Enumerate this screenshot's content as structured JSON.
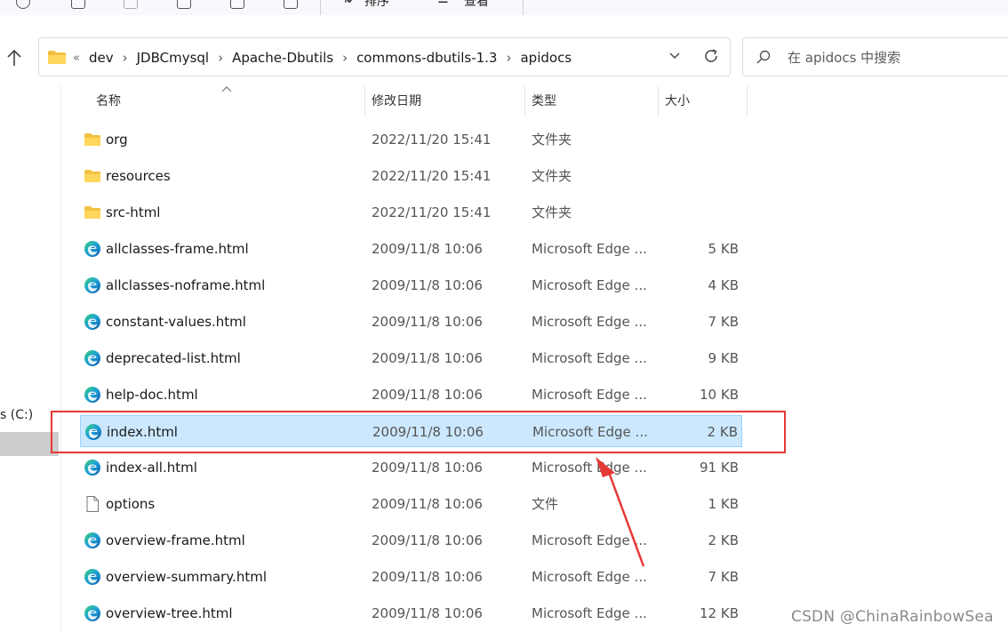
{
  "toolbar": {
    "sort_label": "排序",
    "view_label": "查看",
    "more_label": "···"
  },
  "address_bar": {
    "overflow_marker": "«",
    "crumbs": [
      "dev",
      "JDBCmysql",
      "Apache-Dbutils",
      "commons-dbutils-1.3",
      "apidocs"
    ]
  },
  "search": {
    "placeholder": "在 apidocs 中搜索"
  },
  "nav": {
    "drive_label": "s (C:)"
  },
  "columns": {
    "name": "名称",
    "date": "修改日期",
    "type": "类型",
    "size": "大小"
  },
  "files": [
    {
      "icon": "folder-icon",
      "name": "org",
      "date": "2022/11/20 15:41",
      "type": "文件夹",
      "size": ""
    },
    {
      "icon": "folder-icon",
      "name": "resources",
      "date": "2022/11/20 15:41",
      "type": "文件夹",
      "size": ""
    },
    {
      "icon": "folder-icon",
      "name": "src-html",
      "date": "2022/11/20 15:41",
      "type": "文件夹",
      "size": ""
    },
    {
      "icon": "edge-icon",
      "name": "allclasses-frame.html",
      "date": "2009/11/8 10:06",
      "type": "Microsoft Edge ...",
      "size": "5 KB"
    },
    {
      "icon": "edge-icon",
      "name": "allclasses-noframe.html",
      "date": "2009/11/8 10:06",
      "type": "Microsoft Edge ...",
      "size": "4 KB"
    },
    {
      "icon": "edge-icon",
      "name": "constant-values.html",
      "date": "2009/11/8 10:06",
      "type": "Microsoft Edge ...",
      "size": "7 KB"
    },
    {
      "icon": "edge-icon",
      "name": "deprecated-list.html",
      "date": "2009/11/8 10:06",
      "type": "Microsoft Edge ...",
      "size": "9 KB"
    },
    {
      "icon": "edge-icon",
      "name": "help-doc.html",
      "date": "2009/11/8 10:06",
      "type": "Microsoft Edge ...",
      "size": "10 KB"
    },
    {
      "icon": "edge-icon",
      "name": "index.html",
      "date": "2009/11/8 10:06",
      "type": "Microsoft Edge ...",
      "size": "2 KB",
      "selected": true
    },
    {
      "icon": "edge-icon",
      "name": "index-all.html",
      "date": "2009/11/8 10:06",
      "type": "Microsoft Edge ...",
      "size": "91 KB"
    },
    {
      "icon": "file-icon",
      "name": "options",
      "date": "2009/11/8 10:06",
      "type": "文件",
      "size": "1 KB"
    },
    {
      "icon": "edge-icon",
      "name": "overview-frame.html",
      "date": "2009/11/8 10:06",
      "type": "Microsoft Edge ...",
      "size": "2 KB"
    },
    {
      "icon": "edge-icon",
      "name": "overview-summary.html",
      "date": "2009/11/8 10:06",
      "type": "Microsoft Edge ...",
      "size": "7 KB"
    },
    {
      "icon": "edge-icon",
      "name": "overview-tree.html",
      "date": "2009/11/8 10:06",
      "type": "Microsoft Edge ...",
      "size": "12 KB"
    }
  ],
  "colors": {
    "selection": "#cce8ff",
    "selection_border": "#99d1ff",
    "annotation_red": "#e53935"
  },
  "watermark": "CSDN @ChinaRainbowSea"
}
